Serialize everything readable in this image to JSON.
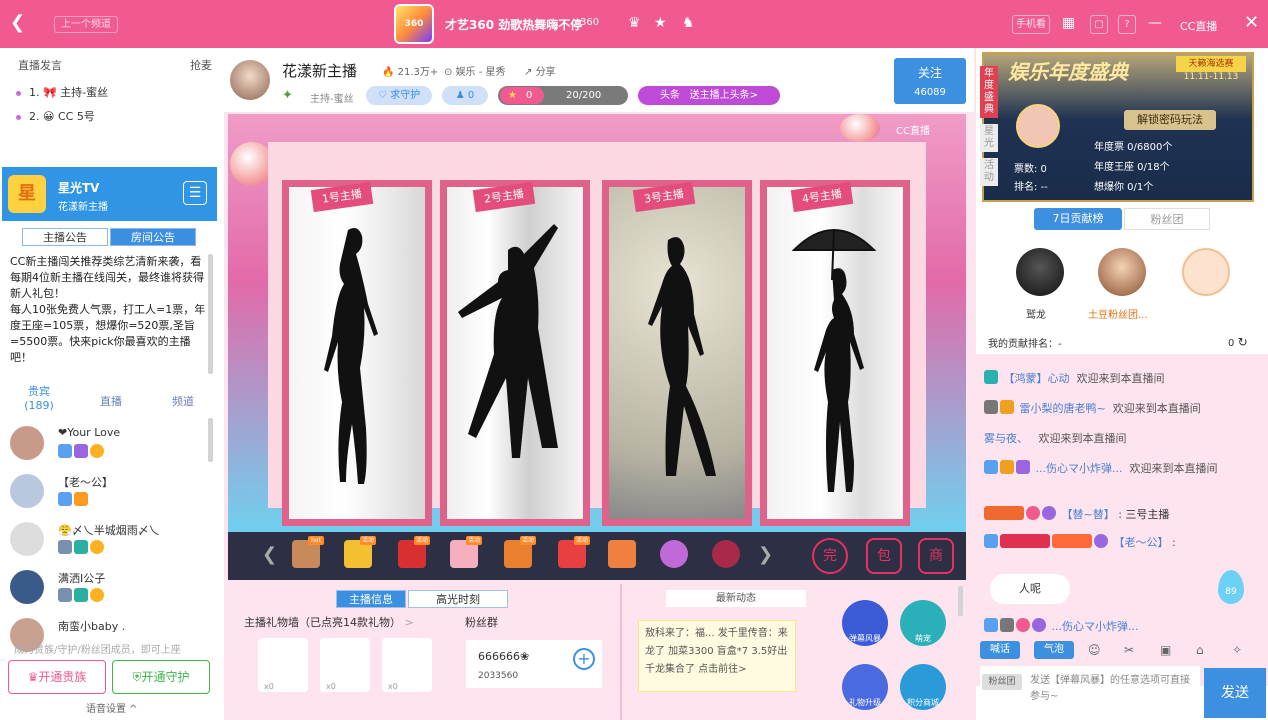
{
  "topbar": {
    "prev": "上一个频道",
    "logo": "360",
    "title": "才艺360 劲歌热舞嗨不停",
    "num": "360",
    "right_btn1": "手机看",
    "cc": "CC直播"
  },
  "left": {
    "header": "直播发言",
    "header_right": "抢麦",
    "queue": [
      "1. 🎀 主持-蜜丝",
      "2. 😀 CC 5号"
    ],
    "channel_title": "星光TV",
    "channel_sub": "花漾新主播",
    "channel_icon": "星",
    "tabs": [
      "主播公告",
      "房间公告"
    ],
    "notice": "CC新主播闯关推荐类综艺清新来袭，看每期4位新主播在线闯关，最终谁将获得新人礼包！\n每人10张免费人气票，打工人=1票，年度王座=105票，想爆你=520票,圣旨=5500票。快来pick你最喜欢的主播吧！",
    "sub_tabs": [
      "贵宾",
      "直播",
      "频道"
    ],
    "guest_count": "(189)",
    "users": [
      {
        "name": "❤Your Love"
      },
      {
        "name": "【老～公】"
      },
      {
        "name": "😤〆乀半城烟雨〆乀"
      },
      {
        "name": "满洒Ⅰ公子"
      },
      {
        "name": "南蛮小baby ."
      }
    ],
    "tip": "成为贵族/守护/粉丝团成员，即可上座",
    "btn_noble": "开通贵族",
    "btn_guard": "开通守护",
    "voice": "语音设置 ^"
  },
  "center": {
    "name": "花漾新主播",
    "hot": "21.3万+",
    "category": "娱乐 - 星秀",
    "share": "分享",
    "sub": "主持-蜜丝",
    "pill_guard": "求守护",
    "pill_fans": "0",
    "pill_level": "0",
    "pill_progress": "20/200",
    "pill_headline": "头条",
    "pill_headline_text": "送主播上头条>",
    "follow": "关注",
    "follow_count": "46089",
    "video_cc": "CC直播",
    "ribbons": [
      "1号主播",
      "2号主播",
      "3号主播",
      "4号主播"
    ],
    "gift_tags": [
      "hot",
      "活动",
      "活动",
      "活动",
      "活动",
      "活动"
    ],
    "right_icons": [
      "完",
      "包",
      "商"
    ],
    "bottom_tabs": [
      "主播信息",
      "高光时刻"
    ],
    "gift_wall": "主播礼物墙（已点亮14款礼物）",
    "fan_club": "粉丝群",
    "slot_counts": [
      "x0",
      "x0",
      "x0"
    ],
    "fan_id": "666666❀",
    "fan_num": "2033560",
    "latest": "最新动态",
    "news": "敖科来了：福... 发千里传音：来龙了 加菜3300 盲盒*7 3.5好出 千龙集合了 点击前往>",
    "circles": [
      "弹幕风暴",
      "萌宠",
      "礼物升级",
      "积分商城"
    ]
  },
  "right": {
    "banner_title": "娱乐年度盛典",
    "banner_tag": "天籁海选赛",
    "banner_date": "11.11-11.13",
    "side_tabs": [
      "年度盛典",
      "星光",
      "活动"
    ],
    "unlock": "解锁密码玩法",
    "votes": "票数: 0",
    "rank": "排名: --",
    "year_ticket": "年度票 0/6800个",
    "year_throne": "年度王座 0/18个",
    "miss_you": "想爆你 0/1个",
    "tabs": [
      "7日贡献榜",
      "粉丝团"
    ],
    "fans": [
      "鹫龙",
      "土豆粉丝团..."
    ],
    "my_rank": "我的贡献排名：-",
    "my_rank_val": "0",
    "chat": [
      {
        "user": "【鸿蒙】心动",
        "msg": "欢迎来到本直播间"
      },
      {
        "user": "雷小梨的唐老鸭~",
        "msg": "欢迎来到本直播间"
      },
      {
        "user": "雾与夜、",
        "msg": "欢迎来到本直播间"
      },
      {
        "user": "...伤心マ小炸弹...",
        "msg": "欢迎来到本直播间"
      },
      {
        "user": "【替~替】",
        "msg": "三号主播"
      },
      {
        "user": "【老～公】",
        "msg": ":"
      },
      {
        "user": "...伤心マ小炸弹...",
        "msg": ""
      }
    ],
    "bubble": "人呢",
    "drop": "89",
    "chip1": "喊话",
    "chip2": "气泡",
    "fan_label": "粉丝团",
    "placeholder": "发送【弹幕风暴】的任意选项可直接参与~",
    "send": "发送"
  }
}
